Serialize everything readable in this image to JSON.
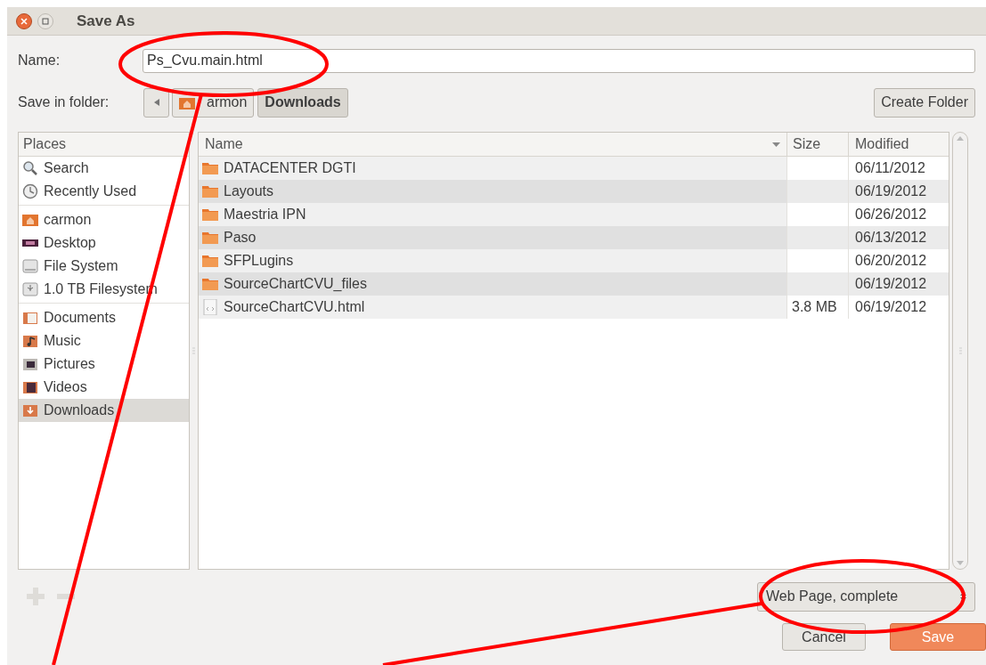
{
  "window": {
    "title": "Save As"
  },
  "name_field": {
    "label": "Name:",
    "value": "Ps_Cvu.main.html"
  },
  "folder_bar": {
    "label": "Save in folder:",
    "crumbs": [
      {
        "label": "armon",
        "selected": false
      },
      {
        "label": "Downloads",
        "selected": true
      }
    ],
    "create_button": "Create Folder"
  },
  "places": {
    "header": "Places",
    "groups": [
      [
        {
          "label": "Search",
          "selected": false
        },
        {
          "label": "Recently Used",
          "selected": false
        }
      ],
      [
        {
          "label": "carmon",
          "selected": false
        },
        {
          "label": "Desktop",
          "selected": false
        },
        {
          "label": "File System",
          "selected": false
        },
        {
          "label": "1.0 TB Filesystem",
          "selected": false
        }
      ],
      [
        {
          "label": "Documents",
          "selected": false
        },
        {
          "label": "Music",
          "selected": false
        },
        {
          "label": "Pictures",
          "selected": false
        },
        {
          "label": "Videos",
          "selected": false
        },
        {
          "label": "Downloads",
          "selected": true
        }
      ]
    ]
  },
  "files": {
    "columns": [
      "Name",
      "Size",
      "Modified"
    ],
    "rows": [
      {
        "kind": "folder",
        "name": "DATACENTER DGTI",
        "modified": "06/11/2012"
      },
      {
        "kind": "folder",
        "name": "Layouts",
        "modified": "06/19/2012"
      },
      {
        "kind": "folder",
        "name": "Maestria IPN",
        "modified": "06/26/2012"
      },
      {
        "kind": "folder",
        "name": "Paso",
        "modified": "06/13/2012"
      },
      {
        "kind": "folder",
        "name": "SFPLugins",
        "modified": "06/20/2012"
      },
      {
        "kind": "folder",
        "name": "SourceChartCVU_files",
        "modified": "06/19/2012"
      },
      {
        "kind": "file",
        "name": "SourceChartCVU.html",
        "size": "3.8 MB",
        "modified": "06/19/2012"
      }
    ]
  },
  "file_type": "Web Page, complete",
  "buttons": [
    {
      "label": "Cancel",
      "kind": "normal"
    },
    {
      "label": "Save",
      "kind": "default"
    }
  ],
  "annotations": [
    {
      "kind": "ellipse"
    },
    {
      "kind": "line"
    },
    {
      "kind": "ellipse"
    },
    {
      "kind": "line"
    }
  ]
}
